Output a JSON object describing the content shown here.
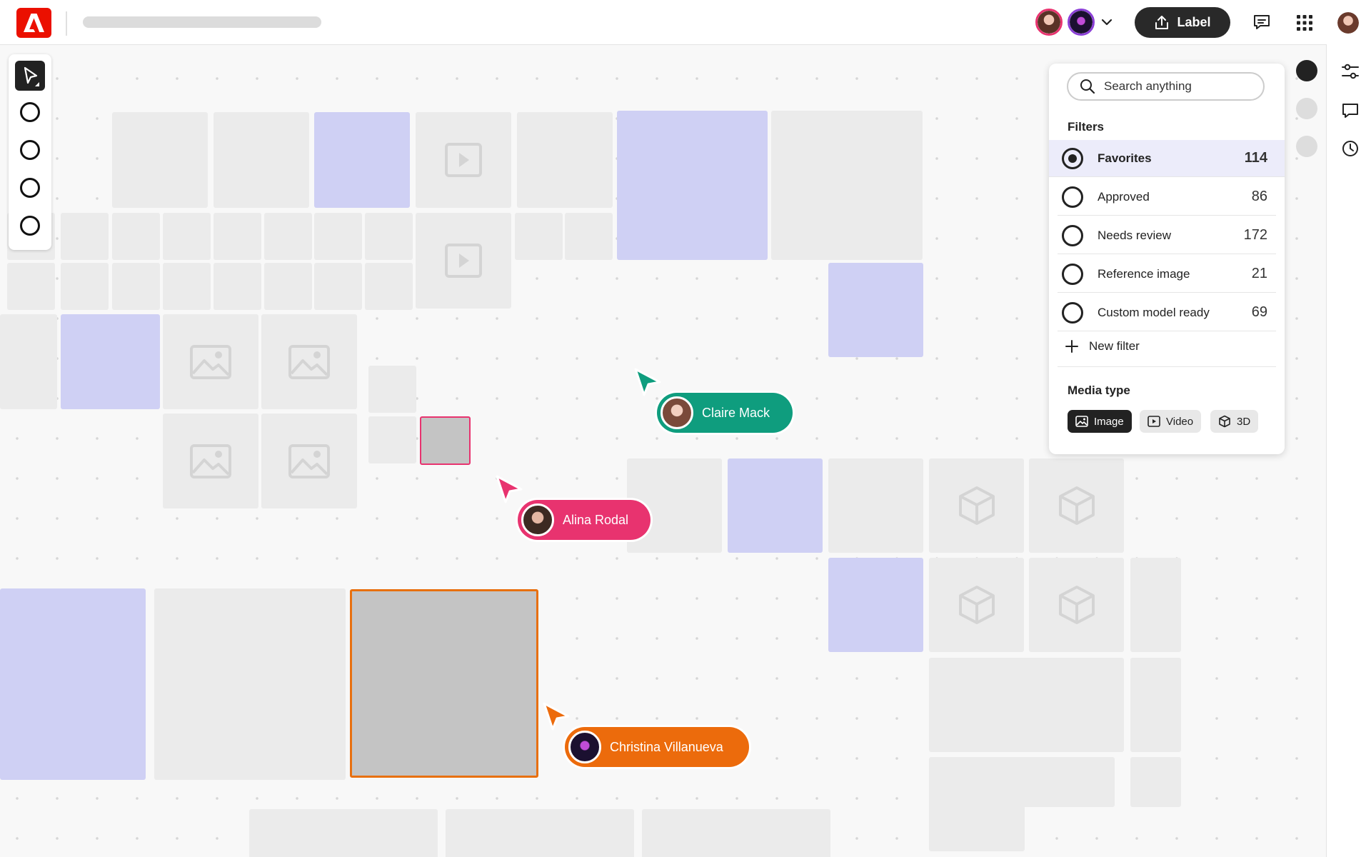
{
  "app": {
    "brand": "Adobe"
  },
  "topbar": {
    "label_button": "Label",
    "collaborators": [
      "Claire Mack",
      "Christina Villanueva"
    ],
    "icons": [
      "adobe-logo-icon",
      "chevron-down-icon",
      "upload-icon",
      "comment-icon",
      "app-grid-icon",
      "user-avatar"
    ]
  },
  "search": {
    "placeholder": "Search anything"
  },
  "filters": {
    "title": "Filters",
    "items": [
      {
        "label": "Favorites",
        "count": "114",
        "selected": true
      },
      {
        "label": "Approved",
        "count": "86",
        "selected": false
      },
      {
        "label": "Needs review",
        "count": "172",
        "selected": false
      },
      {
        "label": "Reference image",
        "count": "21",
        "selected": false
      },
      {
        "label": "Custom model ready",
        "count": "69",
        "selected": false
      }
    ],
    "new_filter": "New filter"
  },
  "media_type": {
    "title": "Media type",
    "options": [
      {
        "label": "Image",
        "selected": true
      },
      {
        "label": "Video",
        "selected": false
      },
      {
        "label": "3D",
        "selected": false
      }
    ]
  },
  "cursors": [
    {
      "name": "Claire Mack",
      "color": "#0f9d7e"
    },
    {
      "name": "Alina Rodal",
      "color": "#e8336f"
    },
    {
      "name": "Christina Villanueva",
      "color": "#ec6b0c"
    }
  ],
  "rail": {
    "icons": [
      "filter-settings-icon",
      "comment-icon",
      "history-icon"
    ]
  },
  "colors": {
    "accent_dark": "#292929",
    "brand_red": "#eb1000",
    "tile_purple": "#cfd0f4",
    "tile_gray": "#ebebeb",
    "selection_orange": "#e8700f",
    "selection_pink": "#e8336f"
  }
}
